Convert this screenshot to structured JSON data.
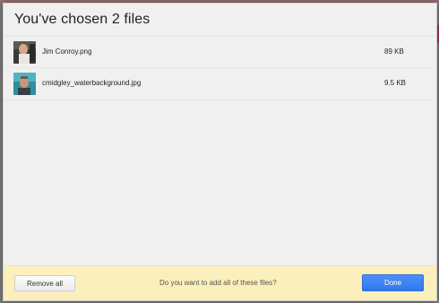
{
  "dialog": {
    "title": "You've chosen 2 files"
  },
  "files": [
    {
      "name": "Jim Conroy.png",
      "size": "89 KB",
      "thumbnail_icon": "portrait-photo-thumbnail"
    },
    {
      "name": "cmidgley_waterbackground.jpg",
      "size": "9.5 KB",
      "thumbnail_icon": "portrait-photo-water-thumbnail"
    }
  ],
  "footer": {
    "remove_all_label": "Remove all",
    "question": "Do you want to add all of these files?",
    "done_label": "Done"
  },
  "colors": {
    "dialog_bg": "#f0f0f0",
    "footer_bg": "#fbefbc",
    "done_button": "#4d90fe"
  }
}
